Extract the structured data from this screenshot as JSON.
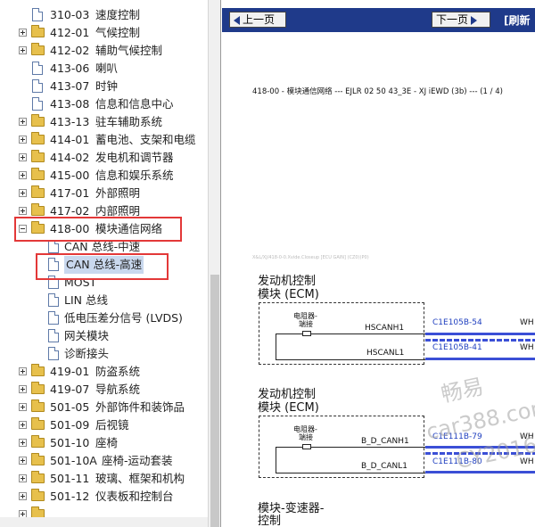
{
  "tree": {
    "items": [
      {
        "code": "310-03",
        "name": "速度控制",
        "type": "doc"
      },
      {
        "code": "412-01",
        "name": "气候控制",
        "type": "folder"
      },
      {
        "code": "412-02",
        "name": "辅助气候控制",
        "type": "folder"
      },
      {
        "code": "413-06",
        "name": "喇叭",
        "type": "doc"
      },
      {
        "code": "413-07",
        "name": "时钟",
        "type": "doc"
      },
      {
        "code": "413-08",
        "name": "信息和信息中心",
        "type": "doc"
      },
      {
        "code": "413-13",
        "name": "驻车辅助系统",
        "type": "folder"
      },
      {
        "code": "414-01",
        "name": "蓄电池、支架和电缆",
        "type": "folder"
      },
      {
        "code": "414-02",
        "name": "发电机和调节器",
        "type": "folder"
      },
      {
        "code": "415-00",
        "name": "信息和娱乐系统",
        "type": "folder"
      },
      {
        "code": "417-01",
        "name": "外部照明",
        "type": "folder"
      },
      {
        "code": "417-02",
        "name": "内部照明",
        "type": "folder"
      },
      {
        "code": "418-00",
        "name": "模块通信网络",
        "type": "folder-open"
      },
      {
        "code": "",
        "name": "CAN 总线-中速",
        "type": "child-doc"
      },
      {
        "code": "",
        "name": "CAN 总线-高速",
        "type": "child-doc",
        "selected": true
      },
      {
        "code": "",
        "name": "MOST",
        "type": "child-doc"
      },
      {
        "code": "",
        "name": "LIN 总线",
        "type": "child-doc"
      },
      {
        "code": "",
        "name": "低电压差分信号 (LVDS)",
        "type": "child-doc"
      },
      {
        "code": "",
        "name": "网关模块",
        "type": "child-doc"
      },
      {
        "code": "",
        "name": "诊断接头",
        "type": "child-doc"
      },
      {
        "code": "419-01",
        "name": "防盗系统",
        "type": "folder"
      },
      {
        "code": "419-07",
        "name": "导航系统",
        "type": "folder"
      },
      {
        "code": "501-05",
        "name": "外部饰件和装饰品",
        "type": "folder"
      },
      {
        "code": "501-09",
        "name": "后视镜",
        "type": "folder"
      },
      {
        "code": "501-10",
        "name": "座椅",
        "type": "folder"
      },
      {
        "code": "501-10A",
        "name": "座椅-运动套装",
        "type": "folder"
      },
      {
        "code": "501-11",
        "name": "玻璃、框架和机构",
        "type": "folder"
      },
      {
        "code": "501-12",
        "name": "仪表板和控制台",
        "type": "folder"
      },
      {
        "code": "",
        "name": "",
        "type": "folder"
      }
    ]
  },
  "toolbar": {
    "prev_label": "上一页",
    "next_label": "下一页",
    "refresh_label": "[刷新"
  },
  "document": {
    "header": "418-00 - 模块通信网络 --- EJLR 02 50 43_3E - XJ iEWD (3b) --- (1 / 4)",
    "faint_line": "X&L/XJ/418-0-0.Xvide.Closeup [ECU GAIN] (CZ0)(P0)",
    "modules": [
      {
        "title_line1": "发动机控制",
        "title_line2": "模块 (ECM)",
        "resistor_label_1": "电阻器-",
        "resistor_label_2": "端接",
        "signals": [
          {
            "name": "HSCANH1",
            "connector": "C1E105B-54",
            "color": "WH"
          },
          {
            "name": "HSCANL1",
            "connector": "C1E105B-41",
            "color": "WH"
          }
        ]
      },
      {
        "title_line1": "发动机控制",
        "title_line2": "模块 (ECM)",
        "resistor_label_1": "电阻器-",
        "resistor_label_2": "端接",
        "signals": [
          {
            "name": "B_D_CANH1",
            "connector": "C1E111B-79",
            "color": "WH"
          },
          {
            "name": "B_D_CANL1",
            "connector": "C1E111B-80",
            "color": "WH"
          }
        ]
      },
      {
        "title_line1": "模块-变速器-",
        "title_line2": "控制"
      }
    ]
  },
  "watermark": {
    "line1": "畅易",
    "line2": "car388.com",
    "line3": "CY2016"
  },
  "colors": {
    "toolbar_bg": "#1f3a8a",
    "connector_text": "#1f3fbf",
    "highlight": "#e33838",
    "wire_blue": "#3b4fd6"
  }
}
